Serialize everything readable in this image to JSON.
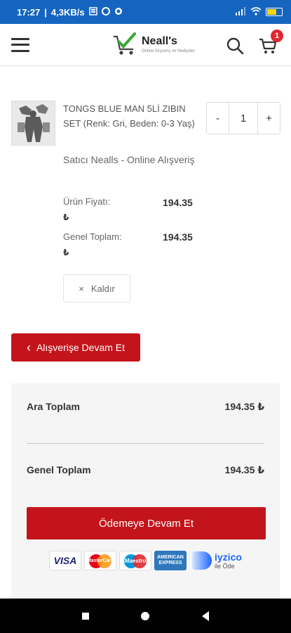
{
  "status_bar": {
    "time": "17:27",
    "speed": "4,3KB/s",
    "battery": "58",
    "colors": {
      "background": "#1565c0",
      "battery_fill": "#ffd600"
    }
  },
  "header": {
    "logo_name": "Neall's",
    "logo_tagline": "Online Alışveriş ve Hediyeler",
    "cart_count": "1"
  },
  "cart_item": {
    "title": "TONGS BLUE MAN 5Lİ ZIBIN SET (Renk: Gri, Beden: 0-3 Yaş)",
    "seller": "Satıcı Nealls - Online Alışveriş",
    "price_label": "Ürün Fiyatı:",
    "price_value": "194.35",
    "total_label": "Genel Toplam:",
    "total_value": "194.35",
    "currency": "₺",
    "quantity": "1",
    "qty_minus": "-",
    "qty_plus": "+",
    "remove_label": "Kaldır",
    "remove_icon": "×"
  },
  "continue_shopping": {
    "label": "Alışverişe Devam Et",
    "icon": "‹"
  },
  "summary": {
    "subtotal_label": "Ara Toplam",
    "subtotal_value": "194.35 ₺",
    "total_label": "Genel Toplam",
    "total_value": "194.35 ₺",
    "checkout_label": "Ödemeye Devam Et",
    "payment_logos": {
      "visa": "VISA",
      "mastercard": "MasterCard",
      "maestro": "Maestro",
      "amex": "AMERICAN EXPRESS",
      "iyzico": "iyzico",
      "iyzico_sub": "ile Öde"
    }
  },
  "colors": {
    "primary_red": "#c4141b",
    "badge_red": "#e0262f",
    "summary_bg": "#f5f5f5"
  }
}
